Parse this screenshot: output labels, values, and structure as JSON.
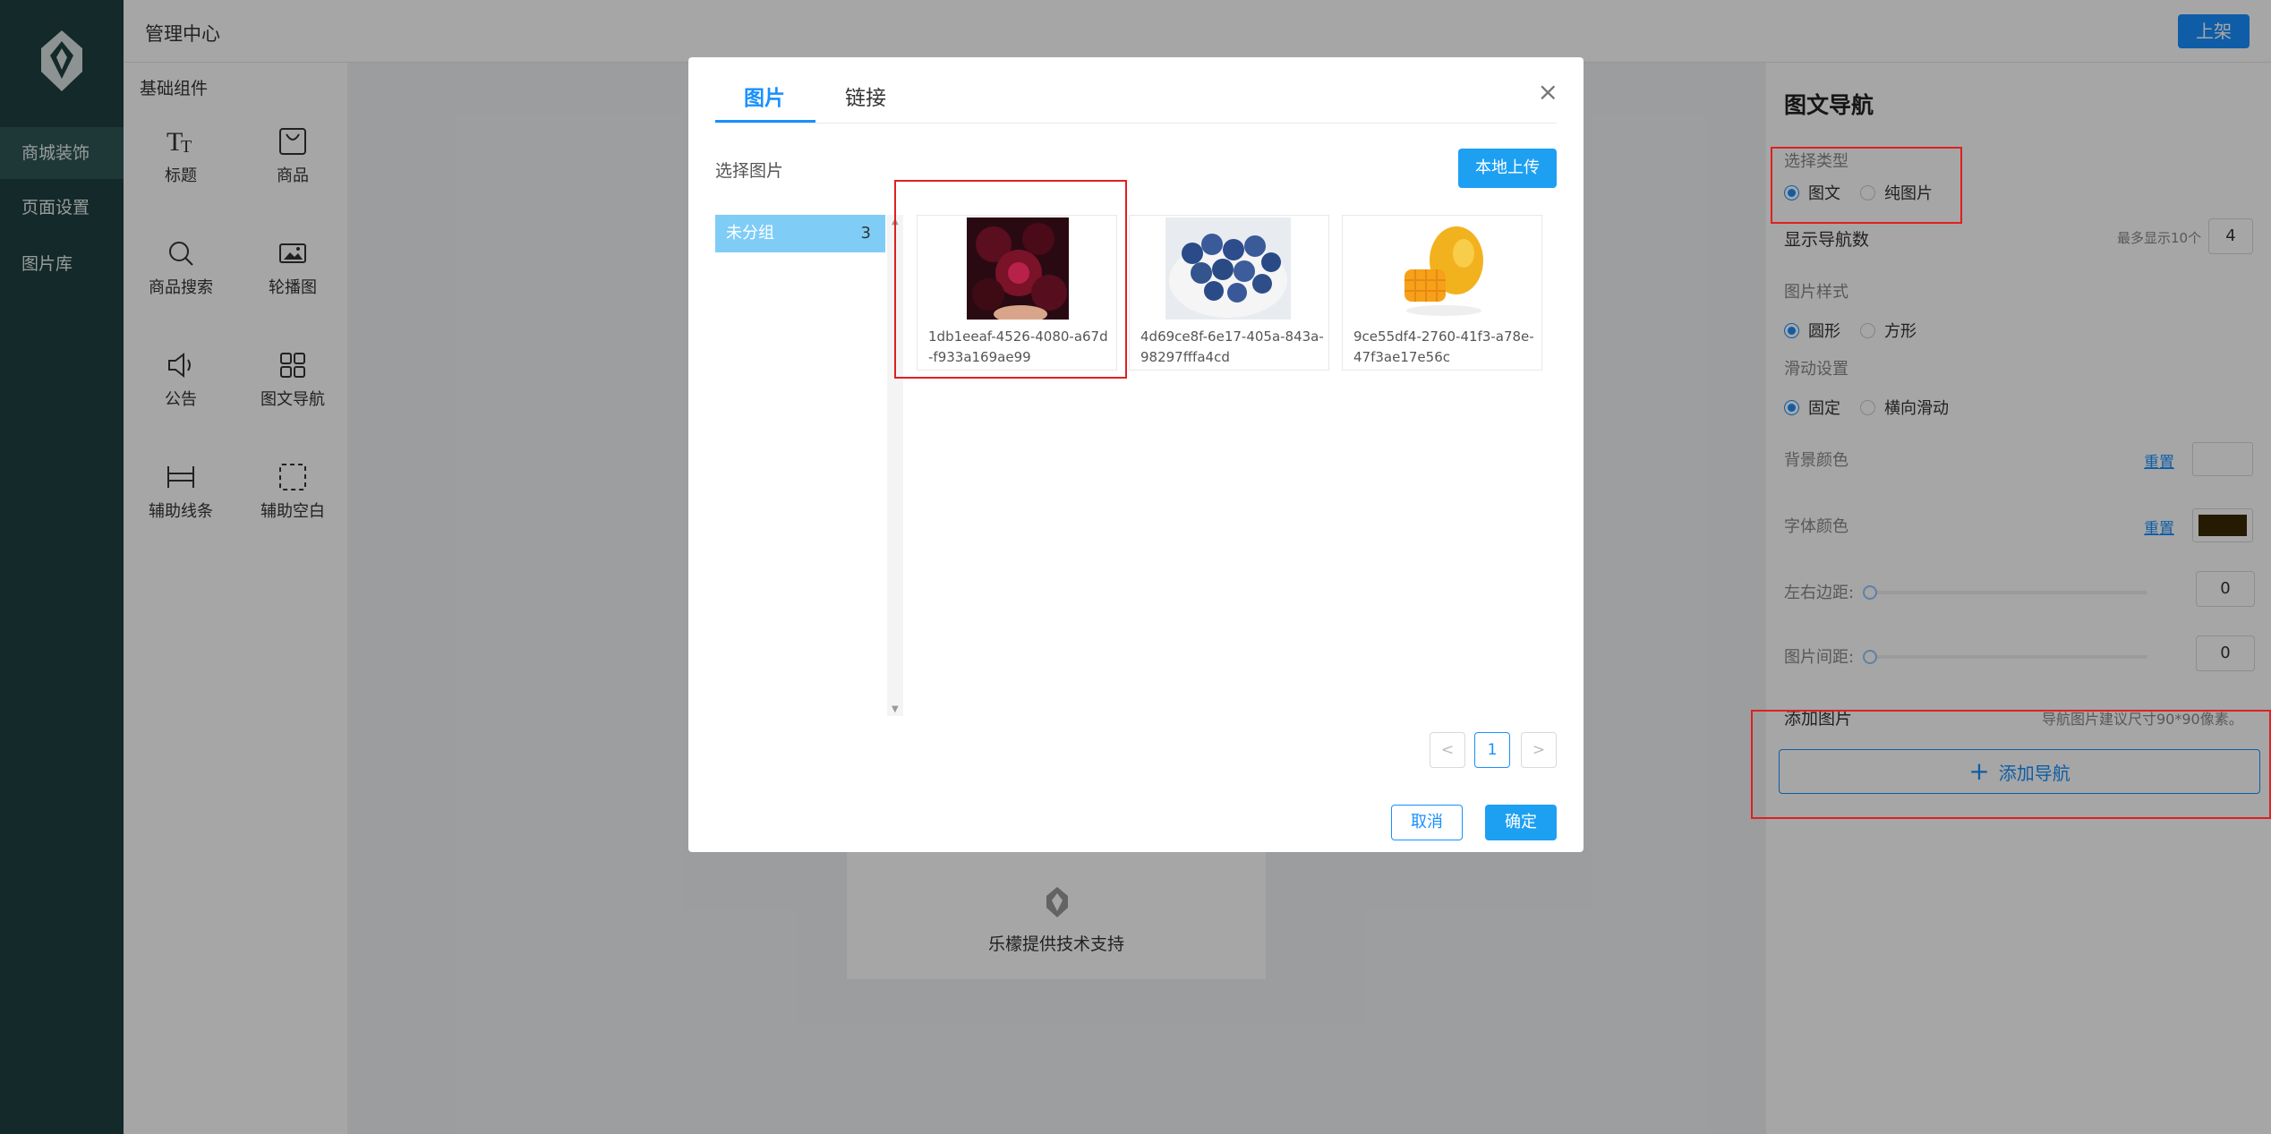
{
  "sidebar": {
    "items": [
      {
        "label": "商城装饰",
        "active": true
      },
      {
        "label": "页面设置",
        "active": false
      },
      {
        "label": "图片库",
        "active": false
      }
    ]
  },
  "header": {
    "title": "管理中心",
    "publish_label": "上架"
  },
  "components": {
    "heading": "基础组件",
    "items": [
      {
        "label": "标题",
        "icon": "text-icon"
      },
      {
        "label": "商品",
        "icon": "shopping-bag-icon"
      },
      {
        "label": "商品搜索",
        "icon": "search-icon"
      },
      {
        "label": "轮播图",
        "icon": "image-carousel-icon"
      },
      {
        "label": "公告",
        "icon": "speaker-icon"
      },
      {
        "label": "图文导航",
        "icon": "grid-icon"
      },
      {
        "label": "辅助线条",
        "icon": "divider-icon"
      },
      {
        "label": "辅助空白",
        "icon": "dashed-square-icon"
      }
    ]
  },
  "canvas": {
    "footer_text": "乐檬提供技术支持"
  },
  "settings": {
    "title": "图文导航",
    "type_label": "选择类型",
    "type_options": [
      "图文",
      "纯图片"
    ],
    "type_selected": "图文",
    "nav_count_label": "显示导航数",
    "nav_count_hint": "最多显示10个",
    "nav_count_value": "4",
    "image_style_label": "图片样式",
    "image_style_options": [
      "圆形",
      "方形"
    ],
    "image_style_selected": "圆形",
    "scroll_label": "滑动设置",
    "scroll_options": [
      "固定",
      "横向滑动"
    ],
    "scroll_selected": "固定",
    "bg_color_label": "背景颜色",
    "bg_color_reset": "重置",
    "bg_color": "#ffffff",
    "font_color_label": "字体颜色",
    "font_color_reset": "重置",
    "font_color": "#3a2a05",
    "margin_label": "左右边距:",
    "margin_value": "0",
    "gap_label": "图片间距:",
    "gap_value": "0",
    "add_image_label": "添加图片",
    "add_image_hint": "导航图片建议尺寸90*90像素。",
    "add_nav_label": "添加导航"
  },
  "modal": {
    "tabs": [
      "图片",
      "链接"
    ],
    "active_tab": "图片",
    "select_label": "选择图片",
    "upload_label": "本地上传",
    "group": {
      "name": "未分组",
      "count": "3"
    },
    "images": [
      {
        "name": "1db1eeaf-4526-4080-a67d-f933a169ae99",
        "subject": "cherries"
      },
      {
        "name": "4d69ce8f-6e17-405a-843a-98297fffa4cd",
        "subject": "blueberries"
      },
      {
        "name": "9ce55df4-2760-41f3-a78e-47f3ae17e56c",
        "subject": "mango"
      }
    ],
    "pagination": {
      "prev": "<",
      "current": "1",
      "next": ">"
    },
    "cancel_label": "取消",
    "ok_label": "确定"
  },
  "colors": {
    "accent": "#1890ff",
    "sidebar_bg": "#1f3f3f",
    "annotation": "#e02020"
  }
}
